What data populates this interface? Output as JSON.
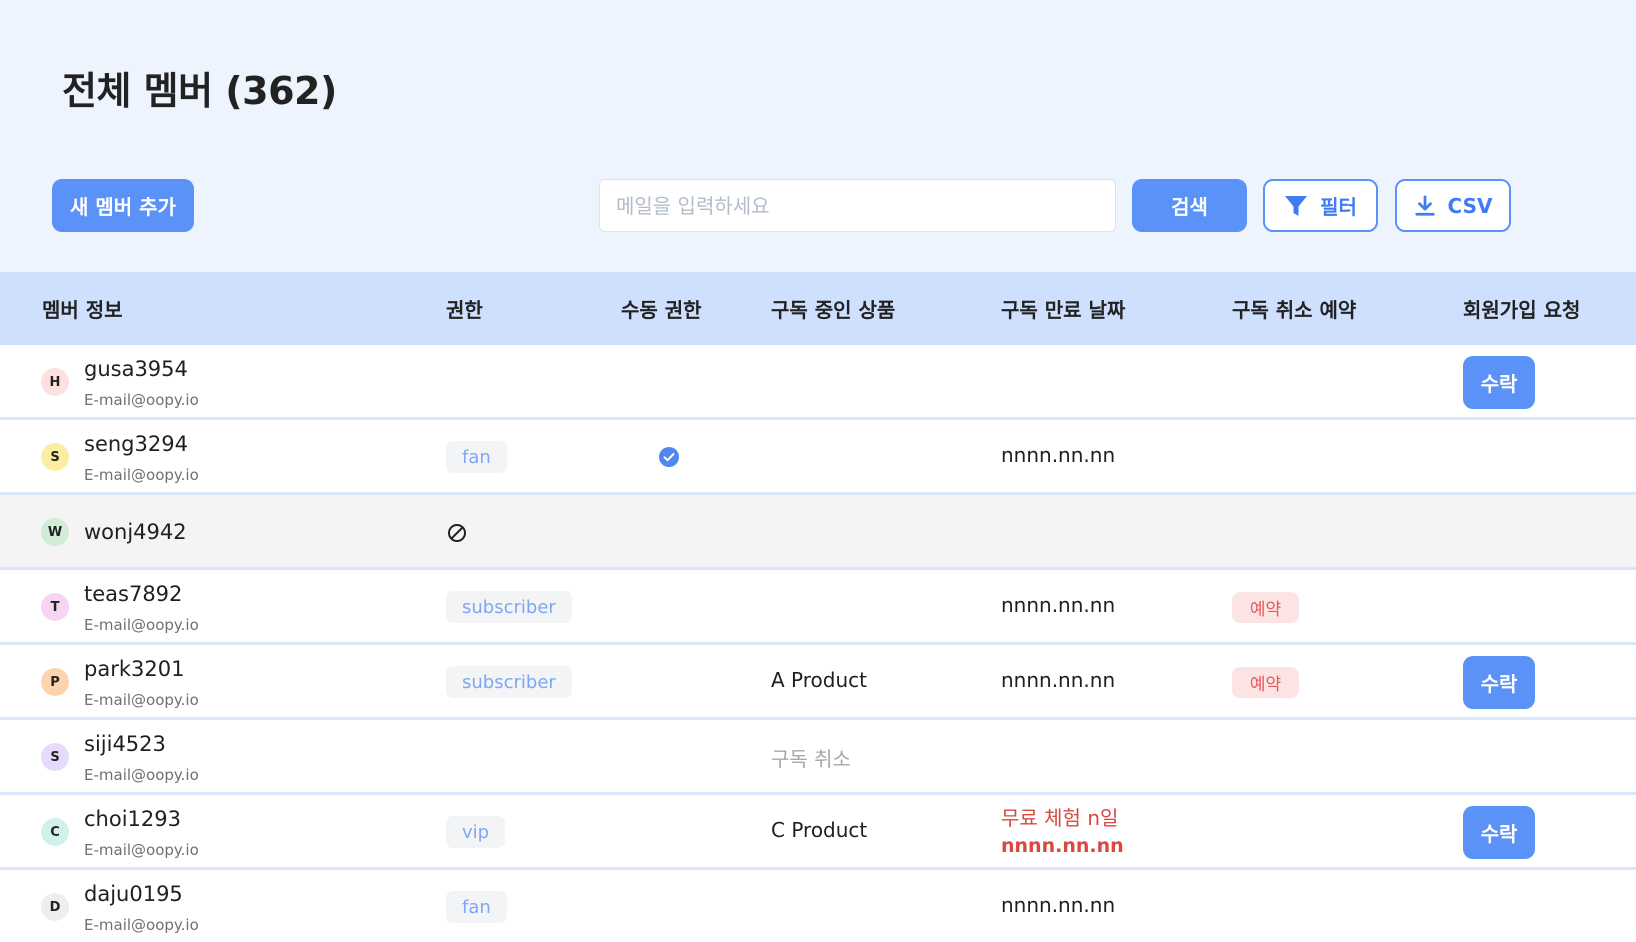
{
  "header": {
    "title": "전체 멤버 (362)",
    "add_member_label": "새 멤버 추가",
    "search_placeholder": "메일을 입력하세요",
    "search_label": "검색",
    "filter_label": "필터",
    "csv_label": "CSV"
  },
  "columns": [
    "멤버 정보",
    "권한",
    "수동 권한",
    "구독 중인 상품",
    "구독 만료 날짜",
    "구독 취소 예약",
    "회원가입 요청"
  ],
  "rows": [
    {
      "initial": "H",
      "avatar_color": "#fde1e1",
      "name": "gusa3954",
      "email": "E-mail@oopy.io",
      "role": "",
      "manual": false,
      "product": "",
      "expiry": "",
      "cancel": "",
      "join": "수락"
    },
    {
      "initial": "S",
      "avatar_color": "#fdeda3",
      "name": "seng3294",
      "email": "E-mail@oopy.io",
      "role": "fan",
      "manual": true,
      "product": "",
      "expiry": "nnnn.nn.nn",
      "cancel": "",
      "join": ""
    },
    {
      "initial": "W",
      "avatar_color": "#d3ecd6",
      "name": "wonj4942",
      "email": "",
      "role": "",
      "banned": true,
      "manual": false,
      "product": "",
      "expiry": "",
      "cancel": "",
      "join": "",
      "highlight": true
    },
    {
      "initial": "T",
      "avatar_color": "#f8d4f3",
      "name": "teas7892",
      "email": "E-mail@oopy.io",
      "role": "subscriber",
      "manual": false,
      "product": "",
      "expiry": "nnnn.nn.nn",
      "cancel": "예약",
      "join": ""
    },
    {
      "initial": "P",
      "avatar_color": "#fdd3ad",
      "name": "park3201",
      "email": "E-mail@oopy.io",
      "role": "subscriber",
      "manual": false,
      "product": "A Product",
      "expiry": "nnnn.nn.nn",
      "cancel": "예약",
      "join": "수락"
    },
    {
      "initial": "S",
      "avatar_color": "#e6dafd",
      "name": "siji4523",
      "email": "E-mail@oopy.io",
      "role": "",
      "manual": false,
      "product": "구독 취소",
      "product_muted": true,
      "expiry": "",
      "cancel": "",
      "join": ""
    },
    {
      "initial": "C",
      "avatar_color": "#d1f1ef",
      "name": "choi1293",
      "email": "E-mail@oopy.io",
      "role": "vip",
      "manual": false,
      "product": "C Product",
      "trial": "무료 체험 n일",
      "expiry": "nnnn.nn.nn",
      "expiry_red": true,
      "cancel": "",
      "join": "수락"
    },
    {
      "initial": "D",
      "avatar_color": "#eeeeee",
      "name": "daju0195",
      "email": "E-mail@oopy.io",
      "role": "fan",
      "manual": false,
      "product": "",
      "expiry": "nnnn.nn.nn",
      "cancel": "",
      "join": ""
    }
  ],
  "colors": {
    "accent": "#5b92f7",
    "header_bg": "#eef4fe",
    "table_head_bg": "#cee0fd",
    "danger": "#d9483e"
  }
}
